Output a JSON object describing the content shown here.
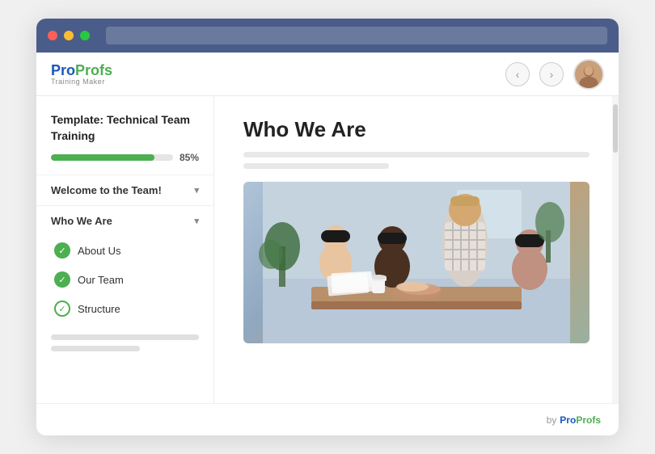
{
  "browser": {
    "title": "ProProfs Training Maker"
  },
  "toolbar": {
    "logo_pro": "Pro",
    "logo_profs": "Profs",
    "logo_subtitle": "Training Maker",
    "prev_label": "‹",
    "next_label": "›"
  },
  "sidebar": {
    "template_title": "Template: Technical Team Training",
    "progress_percent": "85%",
    "progress_value": 85,
    "section1_label": "Welcome to the Team!",
    "section2_label": "Who We Are",
    "item1_label": "About Us",
    "item2_label": "Our Team",
    "item3_label": "Structure"
  },
  "main": {
    "page_title": "Who We Are",
    "image_alt": "Team collaboration photo"
  },
  "footer": {
    "by_label": "by",
    "pro1": "Pro",
    "pro2": "Profs"
  }
}
